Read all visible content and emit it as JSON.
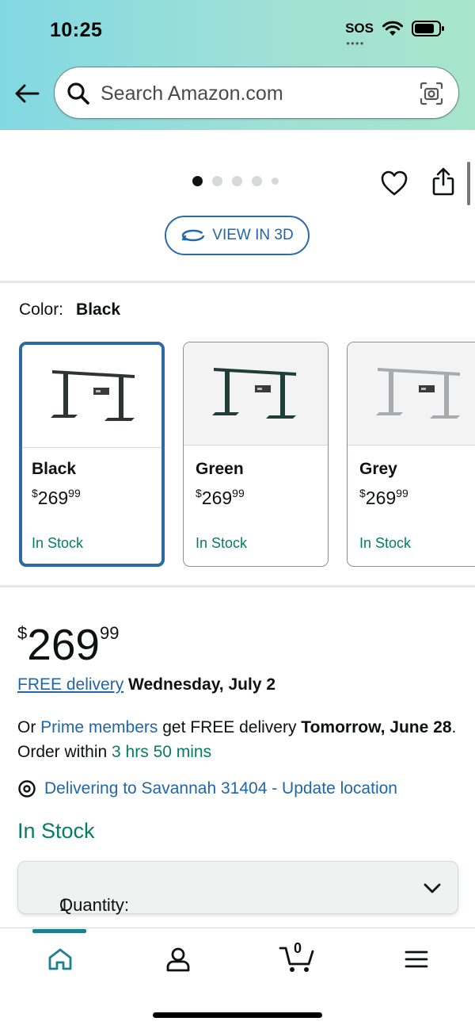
{
  "status_bar": {
    "time": "10:25",
    "sos": "SOS"
  },
  "search": {
    "placeholder": "Search Amazon.com"
  },
  "gallery": {
    "image_count": 5,
    "active_index": 0,
    "view_3d_label": "VIEW IN 3D"
  },
  "color": {
    "label": "Color:",
    "selected": "Black",
    "options": [
      {
        "name": "Black",
        "currency": "$",
        "price_whole": "269",
        "price_cents": "99",
        "stock": "In Stock",
        "frame_color": "#2e3436"
      },
      {
        "name": "Green",
        "currency": "$",
        "price_whole": "269",
        "price_cents": "99",
        "stock": "In Stock",
        "frame_color": "#1f3f36"
      },
      {
        "name": "Grey",
        "currency": "$",
        "price_whole": "269",
        "price_cents": "99",
        "stock": "In Stock",
        "frame_color": "#a8abae"
      }
    ]
  },
  "price": {
    "currency": "$",
    "whole": "269",
    "cents": "99"
  },
  "delivery": {
    "free_delivery_link": "FREE delivery",
    "free_delivery_date": "Wednesday, July 2",
    "prime_prefix": "Or",
    "prime_link": "Prime members",
    "prime_middle": "get FREE delivery",
    "prime_date": "Tomorrow, June 28",
    "order_within_label": ". Order within",
    "order_within_time": "3 hrs 50 mins",
    "location": "Delivering to Savannah 31404 - Update location"
  },
  "availability": "In Stock",
  "quantity": {
    "label": "Quantity:",
    "value": "1"
  },
  "bottom_nav": {
    "cart_count": "0",
    "active": "home"
  },
  "colors": {
    "accent_teal": "#1b8091",
    "link_blue": "#2166a6",
    "stock_green": "#067d62"
  }
}
